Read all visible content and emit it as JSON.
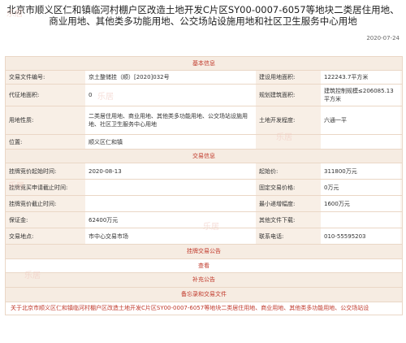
{
  "page": {
    "title": "北京市顺义区仁和镇临河村棚户区改造土地开发C片区SY00-0007-6057等地块二类居住用地、商业用地、其他类多功能用地、公交场站设施用地和社区卫生服务中心用地",
    "date": "2020-07-24"
  },
  "sections": {
    "basic": "基本信息",
    "trade": "交易信息",
    "announce": "挂牌交易公告",
    "view": "查看",
    "supplement": "补充公告",
    "docs": "备忘录和交易文件"
  },
  "basic": {
    "r1": {
      "l1": "交易文件编号:",
      "v1": "京土整储挂（顺）[2020]032号",
      "l2": "建设用地面积:",
      "v2": "122243.7平方米"
    },
    "r2": {
      "l1": "代征地面积:",
      "v1": "0",
      "l2": "规划建筑面积:",
      "v2": "建筑控制规模≤206085.13平方米"
    },
    "r3": {
      "l1": "用地性质:",
      "v1": "二类居住用地、商业用地、其他类多功能用地、公交场站设施用地、社区卫生服务中心用地",
      "l2": "土地开发程度:",
      "v2": "六通一平"
    },
    "r4": {
      "l1": "位置:",
      "v1": "顺义区仁和镇",
      "l2": "",
      "v2": ""
    }
  },
  "trade": {
    "r1": {
      "l1": "挂牌竞价起始时间:",
      "v1": "2020-08-13",
      "l2": "起始价:",
      "v2": "311800万元"
    },
    "r2": {
      "l1": "挂牌竞买申请截止时间:",
      "v1": "",
      "l2": "固定交易价格:",
      "v2": "0万元"
    },
    "r3": {
      "l1": "挂牌竞价截止时间:",
      "v1": "",
      "l2": "最小递增幅度:",
      "v2": "1600万元"
    },
    "r4": {
      "l1": "保证金:",
      "v1": "62400万元",
      "l2": "其他文件下载:",
      "v2": ""
    },
    "r5": {
      "l1": "交易地点:",
      "v1": "市中心交易市场",
      "l2": "联系电话:",
      "v2": "010-55595203"
    }
  },
  "doc_link": "关于北京市顺义区仁和镇临河村棚户区改造土地开发C片区SY00-0007-6057等地块二类居住用地、商业用地、其他类多功能用地、公交场站设",
  "watermark": "乐居",
  "colors": {
    "accent": "#c0392b",
    "header_bg": "#f6ece2",
    "label_bg": "#f8efe6",
    "border": "#ead7c6"
  }
}
